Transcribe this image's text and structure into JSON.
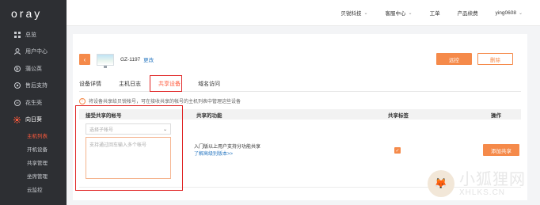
{
  "brand": {
    "logo": "oray"
  },
  "sidebar": {
    "items": [
      {
        "label": "总览",
        "icon": "grid-icon"
      },
      {
        "label": "用户中心",
        "icon": "user-icon"
      },
      {
        "label": "蒲公英",
        "icon": "bluetooth-icon"
      },
      {
        "label": "售后支持",
        "icon": "support-icon"
      },
      {
        "label": "花生壳",
        "icon": "peanut-icon"
      },
      {
        "label": "向日葵",
        "icon": "sunflower-icon"
      }
    ],
    "sub_items": [
      {
        "label": "主机列表",
        "active": true
      },
      {
        "label": "开机设备",
        "active": false
      },
      {
        "label": "共享管理",
        "active": false
      },
      {
        "label": "坐席管理",
        "active": false
      },
      {
        "label": "云监控",
        "active": false
      }
    ]
  },
  "topbar": {
    "company": "贝锐科技",
    "service": "客服中心",
    "tickets": "工单",
    "pricing": "产品续费",
    "user": "ying0608"
  },
  "host": {
    "name": "GZ-1197",
    "edit_label": "更改",
    "primary_button": "远控",
    "delete_button": "删除"
  },
  "tabs": [
    {
      "label": "设备详情",
      "active": false
    },
    {
      "label": "主机日志",
      "active": false
    },
    {
      "label": "共享设备",
      "active": true
    },
    {
      "label": "域名访问",
      "active": false
    }
  ],
  "notice": "将设备共享给贝锐帐号，可在接收共享的帐号的主机列表中管理这些设备",
  "table": {
    "headers": [
      "接受共享的帐号",
      "共享的功能",
      "共享标签",
      "操作"
    ],
    "select_placeholder": "选择子帐号",
    "textarea_placeholder": "支持通过回车输入多个帐号",
    "description": "入门版以上用户支持分功能共享",
    "link": "了解高级别版本>>",
    "action_button": "添加共享"
  },
  "watermark": {
    "cn": "小狐狸网",
    "en": "XHLKS.CN"
  },
  "colors": {
    "accent": "#f58a4a",
    "highlight": "#e02424",
    "sidebar": "#2d2f33"
  }
}
